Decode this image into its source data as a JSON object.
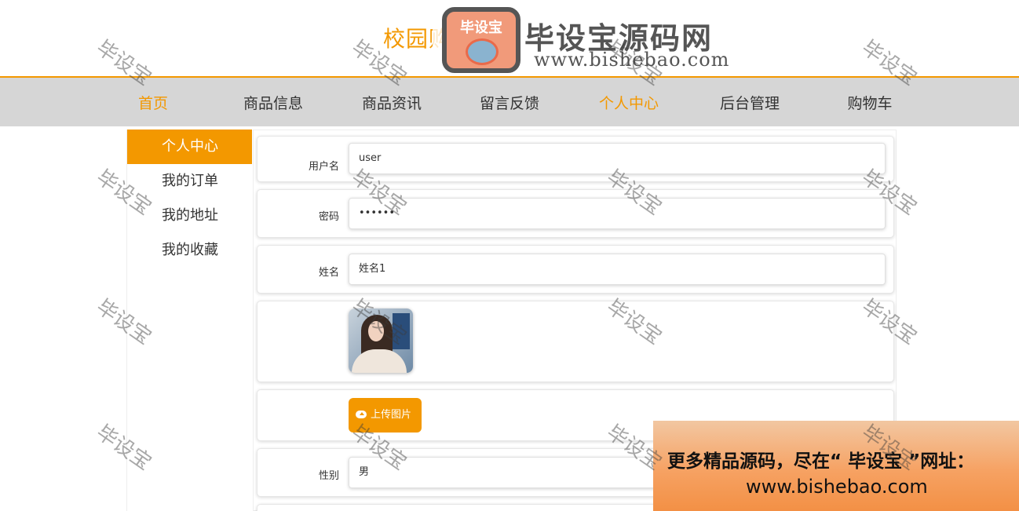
{
  "site": {
    "title": "校园购物网站"
  },
  "logo": {
    "badge_text": "毕设宝",
    "name_cn": "毕设宝源码网",
    "url": "www.bishebao.com"
  },
  "nav": {
    "items": [
      {
        "label": "首页",
        "active": true
      },
      {
        "label": "商品信息"
      },
      {
        "label": "商品资讯"
      },
      {
        "label": "留言反馈"
      },
      {
        "label": "个人中心",
        "active": true
      },
      {
        "label": "后台管理"
      },
      {
        "label": "购物车"
      }
    ]
  },
  "sidebar": {
    "items": [
      {
        "label": "个人中心",
        "active": true
      },
      {
        "label": "我的订单"
      },
      {
        "label": "我的地址"
      },
      {
        "label": "我的收藏"
      }
    ]
  },
  "form": {
    "username": {
      "label": "用户名",
      "value": "user"
    },
    "password": {
      "label": "密码",
      "value": "••••••"
    },
    "name": {
      "label": "姓名",
      "value": "姓名1"
    },
    "upload_label": "上传图片",
    "gender": {
      "label": "性别",
      "value": "男"
    }
  },
  "watermark": {
    "text": "毕设宝"
  },
  "promo": {
    "line1": "更多精品源码，尽在“ 毕设宝 ”网址：",
    "line2": "www.bishebao.com"
  },
  "colors": {
    "accent": "#f39800",
    "nav_bg": "#d6d6d6"
  }
}
